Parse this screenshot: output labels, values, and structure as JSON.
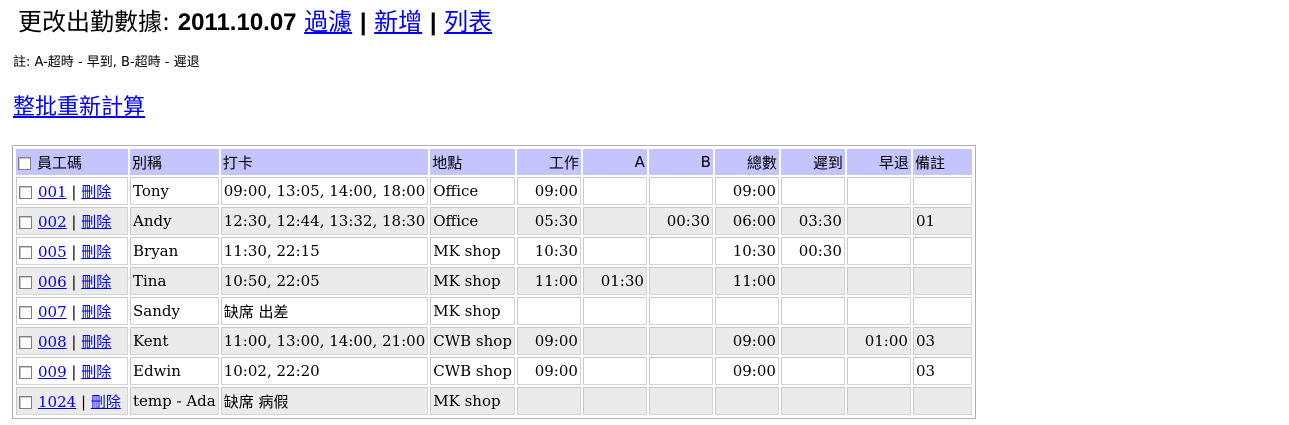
{
  "header": {
    "label": "更改出勤數據:",
    "date": "2011.10.07",
    "links": [
      "過濾",
      "新增",
      "列表"
    ],
    "separator": "|"
  },
  "note": "註: A-超時 - 早到, B-超時 - 遲退",
  "recalc_link": "整批重新計算",
  "table": {
    "columns": {
      "code": "員工碼",
      "name": "別稱",
      "punch": "打卡",
      "location": "地點",
      "work": "工作",
      "a": "A",
      "b": "B",
      "total": "總數",
      "late": "遲到",
      "early": "早退",
      "remark": "備註"
    },
    "delete_label": "刪除",
    "rows": [
      {
        "code": "001",
        "name": "Tony",
        "punch": "09:00, 13:05, 14:00, 18:00",
        "location": "Office",
        "work": "09:00",
        "a": "",
        "b": "",
        "total": "09:00",
        "late": "",
        "early": "",
        "remark": ""
      },
      {
        "code": "002",
        "name": "Andy",
        "punch": "12:30, 12:44, 13:32, 18:30",
        "location": "Office",
        "work": "05:30",
        "a": "",
        "b": "00:30",
        "total": "06:00",
        "late": "03:30",
        "early": "",
        "remark": "01"
      },
      {
        "code": "005",
        "name": "Bryan",
        "punch": "11:30, 22:15",
        "location": "MK shop",
        "work": "10:30",
        "a": "",
        "b": "",
        "total": "10:30",
        "late": "00:30",
        "early": "",
        "remark": ""
      },
      {
        "code": "006",
        "name": "Tina",
        "punch": "10:50, 22:05",
        "location": "MK shop",
        "work": "11:00",
        "a": "01:30",
        "b": "",
        "total": "11:00",
        "late": "",
        "early": "",
        "remark": ""
      },
      {
        "code": "007",
        "name": "Sandy",
        "punch": "缺席 出差",
        "location": "MK shop",
        "work": "",
        "a": "",
        "b": "",
        "total": "",
        "late": "",
        "early": "",
        "remark": ""
      },
      {
        "code": "008",
        "name": "Kent",
        "punch": "11:00, 13:00, 14:00, 21:00",
        "location": "CWB shop",
        "work": "09:00",
        "a": "",
        "b": "",
        "total": "09:00",
        "late": "",
        "early": "01:00",
        "remark": "03"
      },
      {
        "code": "009",
        "name": "Edwin",
        "punch": "10:02, 22:20",
        "location": "CWB shop",
        "work": "09:00",
        "a": "",
        "b": "",
        "total": "09:00",
        "late": "",
        "early": "",
        "remark": "03"
      },
      {
        "code": "1024",
        "name": "temp - Ada",
        "punch": "缺席 病假",
        "location": "MK shop",
        "work": "",
        "a": "",
        "b": "",
        "total": "",
        "late": "",
        "early": "",
        "remark": ""
      }
    ]
  }
}
